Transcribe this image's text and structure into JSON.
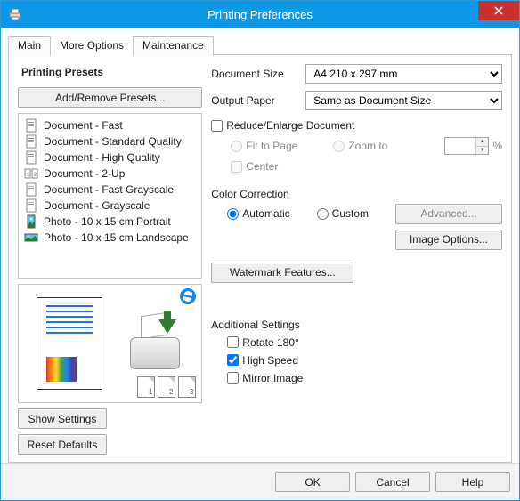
{
  "title": "Printing Preferences",
  "tabs": [
    "Main",
    "More Options",
    "Maintenance"
  ],
  "active_tab": 1,
  "left": {
    "heading": "Printing Presets",
    "add_remove": "Add/Remove Presets...",
    "presets": [
      "Document - Fast",
      "Document - Standard Quality",
      "Document - High Quality",
      "Document - 2-Up",
      "Document - Fast Grayscale",
      "Document - Grayscale",
      "Photo - 10 x 15 cm Portrait",
      "Photo - 10 x 15 cm Landscape"
    ],
    "mini_pages": [
      "1",
      "2",
      "3"
    ],
    "show_settings": "Show Settings",
    "reset_defaults": "Reset Defaults"
  },
  "right": {
    "doc_size_label": "Document Size",
    "doc_size_value": "A4 210 x 297 mm",
    "output_paper_label": "Output Paper",
    "output_paper_value": "Same as Document Size",
    "reduce_enlarge": "Reduce/Enlarge Document",
    "fit_to_page": "Fit to Page",
    "zoom_to": "Zoom to",
    "zoom_value": "",
    "percent": "%",
    "center": "Center",
    "color_correction": "Color Correction",
    "automatic": "Automatic",
    "custom": "Custom",
    "advanced": "Advanced...",
    "image_options": "Image Options...",
    "watermark": "Watermark Features...",
    "additional": "Additional Settings",
    "rotate": "Rotate 180°",
    "high_speed": "High Speed",
    "mirror": "Mirror Image",
    "high_speed_checked": true
  },
  "footer": {
    "ok": "OK",
    "cancel": "Cancel",
    "help": "Help"
  }
}
